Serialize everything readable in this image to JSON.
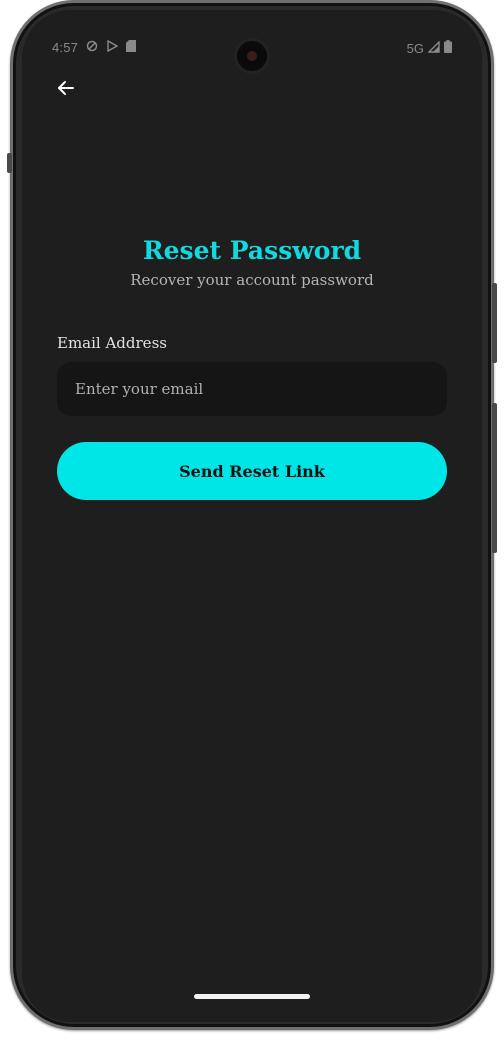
{
  "status_bar": {
    "time": "4:57",
    "network": "5G",
    "icons_left": [
      "vpn-shield-icon",
      "play-store-icon",
      "sd-card-icon"
    ],
    "icons_right": [
      "signal-icon",
      "battery-icon"
    ]
  },
  "header": {
    "back_icon": "arrow-left-icon"
  },
  "reset": {
    "title": "Reset Password",
    "subtitle": "Recover your account password",
    "email_label": "Email Address",
    "email_placeholder": "Enter your email",
    "email_value": "",
    "submit_label": "Send Reset Link"
  },
  "colors": {
    "background": "#1e1e1e",
    "accent": "#00e6e6",
    "title": "#11d9de",
    "input_bg": "#151515"
  }
}
